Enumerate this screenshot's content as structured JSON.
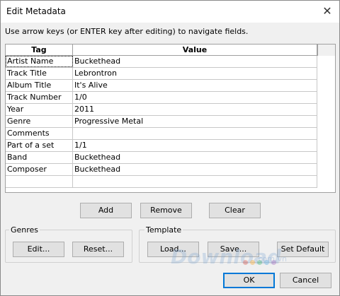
{
  "window": {
    "title": "Edit Metadata",
    "hint": "Use arrow keys (or ENTER key after editing) to navigate fields."
  },
  "grid": {
    "columns": [
      "Tag",
      "Value"
    ],
    "rows": [
      {
        "tag": "Artist Name",
        "value": "Buckethead"
      },
      {
        "tag": "Track Title",
        "value": "Lebrontron"
      },
      {
        "tag": "Album Title",
        "value": "It's Alive"
      },
      {
        "tag": "Track Number",
        "value": "1/0"
      },
      {
        "tag": "Year",
        "value": "2011"
      },
      {
        "tag": "Genre",
        "value": "Progressive Metal"
      },
      {
        "tag": "Comments",
        "value": ""
      },
      {
        "tag": "Part of a set",
        "value": "1/1"
      },
      {
        "tag": "Band",
        "value": "Buckethead"
      },
      {
        "tag": "Composer",
        "value": "Buckethead"
      },
      {
        "tag": "",
        "value": ""
      }
    ]
  },
  "row_buttons": {
    "add": "Add",
    "remove": "Remove",
    "clear": "Clear"
  },
  "genres": {
    "label": "Genres",
    "edit": "Edit...",
    "reset": "Reset..."
  },
  "template": {
    "label": "Template",
    "load": "Load...",
    "save": "Save...",
    "set_default": "Set Default"
  },
  "dialog_buttons": {
    "ok": "OK",
    "cancel": "Cancel"
  },
  "watermark": {
    "text": "Download",
    "domain": ".com.vn",
    "colors": [
      "#e74c3c",
      "#f39c12",
      "#27ae60",
      "#3498db",
      "#9b59b6"
    ]
  }
}
